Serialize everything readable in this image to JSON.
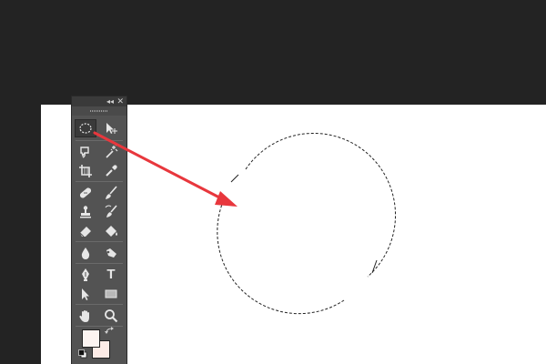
{
  "colors": {
    "app_bg": "#232323",
    "canvas": "#ffffff",
    "panel": "#535353",
    "icon": "#e6e6e6",
    "arrow": "#e8373d",
    "foreground_color": "#fcf4f1",
    "background_color": "#fcebe6"
  },
  "toolbar": {
    "collapse_glyph": "◂◂",
    "close_glyph": "✕",
    "tools": [
      {
        "name": "elliptical-marquee-tool",
        "icon": "elliptical-marquee-icon",
        "active": true
      },
      {
        "name": "path-selection-tool",
        "icon": "path-selection-icon"
      },
      {
        "name": "lasso-tool",
        "icon": "lasso-icon"
      },
      {
        "name": "magic-wand-tool",
        "icon": "magic-wand-icon"
      },
      {
        "name": "crop-tool",
        "icon": "crop-icon"
      },
      {
        "name": "eyedropper-tool",
        "icon": "eyedropper-icon"
      },
      {
        "name": "healing-brush-tool",
        "icon": "bandage-icon"
      },
      {
        "name": "brush-tool",
        "icon": "brush-icon"
      },
      {
        "name": "clone-stamp-tool",
        "icon": "stamp-icon"
      },
      {
        "name": "history-brush-tool",
        "icon": "history-brush-icon"
      },
      {
        "name": "eraser-tool",
        "icon": "eraser-icon"
      },
      {
        "name": "paint-bucket-tool",
        "icon": "paint-bucket-icon"
      },
      {
        "name": "blur-tool",
        "icon": "blur-drop-icon"
      },
      {
        "name": "dodge-tool",
        "icon": "dodge-icon"
      },
      {
        "name": "pen-tool",
        "icon": "pen-icon"
      },
      {
        "name": "type-tool",
        "icon": "type-icon",
        "glyph": "T"
      },
      {
        "name": "direct-selection-tool",
        "icon": "direct-selection-icon"
      },
      {
        "name": "rectangle-tool",
        "icon": "rectangle-icon"
      },
      {
        "name": "hand-tool",
        "icon": "hand-icon"
      },
      {
        "name": "zoom-tool",
        "icon": "zoom-icon"
      }
    ]
  }
}
